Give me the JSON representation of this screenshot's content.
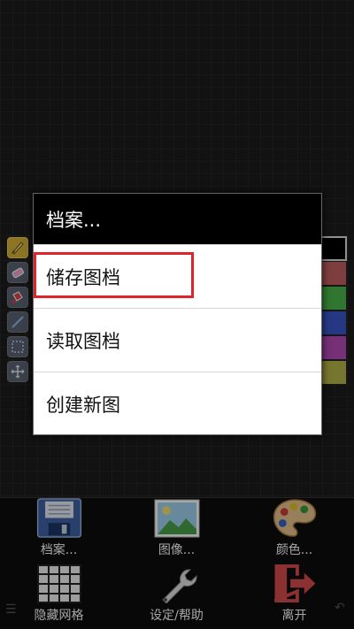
{
  "dialog": {
    "title": "档案...",
    "items": [
      {
        "label": "储存图档"
      },
      {
        "label": "读取图档"
      },
      {
        "label": "创建新图"
      }
    ]
  },
  "toolbar": {
    "file_label": "档案...",
    "image_label": "图像...",
    "color_label": "颜色...",
    "grid_label": "隐藏网格",
    "settings_label": "设定/帮助",
    "exit_label": "离开"
  },
  "palette": [
    "#000000",
    "#c46060",
    "#4bb54b",
    "#3b57c9",
    "#b54bb5",
    "#b5b54b"
  ],
  "tools": [
    "pencil-icon",
    "eraser-icon",
    "fill-icon",
    "line-icon",
    "select-icon",
    "move-icon"
  ],
  "colors": {
    "highlight": "#e0222a",
    "active_tool": "#d9b23a"
  }
}
